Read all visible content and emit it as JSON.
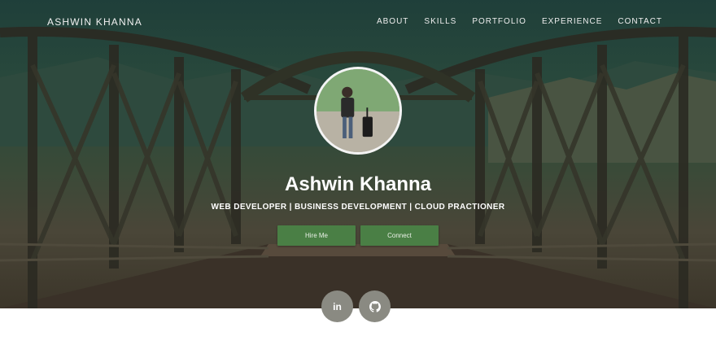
{
  "nav": {
    "brand": "ASHWIN KHANNA",
    "links": [
      "ABOUT",
      "SKILLS",
      "PORTFOLIO",
      "EXPERIENCE",
      "CONTACT"
    ]
  },
  "hero": {
    "name": "Ashwin Khanna",
    "subtitle": "WEB DEVELOPER | BUSINESS DEVELOPMENT | CLOUD PRACTIONER",
    "hire_label": "Hire Me",
    "connect_label": "Connect"
  },
  "social": {
    "linkedin_glyph": "in",
    "github_icon": "github-icon"
  },
  "colors": {
    "button_bg": "#4a7f45",
    "social_bg": "#8a8a82"
  }
}
